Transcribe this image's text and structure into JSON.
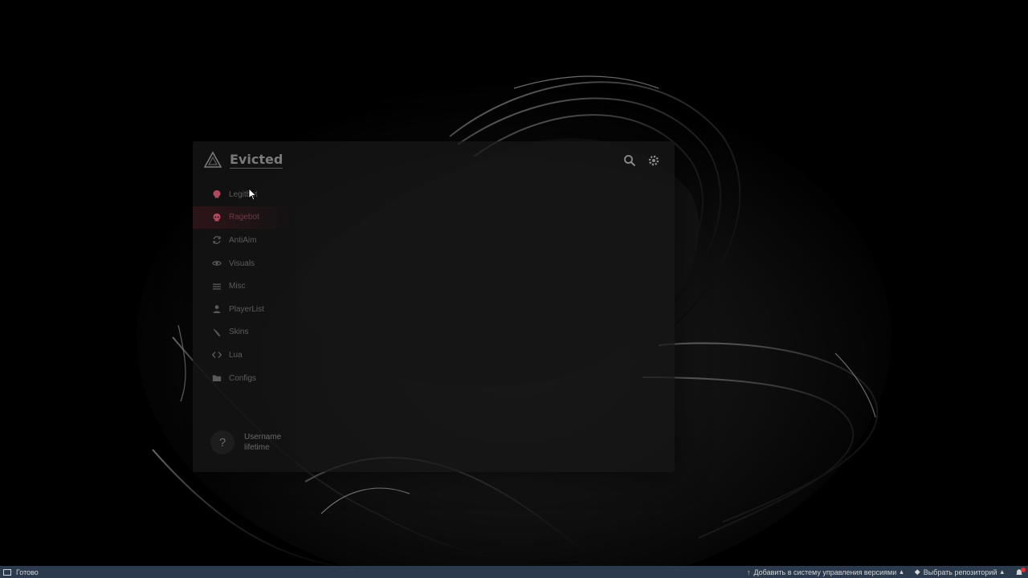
{
  "menu": {
    "title": "Evicted",
    "nav": [
      {
        "label": "Legitbot",
        "icon": "skull-icon"
      },
      {
        "label": "Ragebot",
        "icon": "skull-icon"
      },
      {
        "label": "AntiAim",
        "icon": "refresh-icon"
      },
      {
        "label": "Visuals",
        "icon": "eye-icon"
      },
      {
        "label": "Misc",
        "icon": "menu-icon"
      },
      {
        "label": "PlayerList",
        "icon": "user-icon"
      },
      {
        "label": "Skins",
        "icon": "knife-icon"
      },
      {
        "label": "Lua",
        "icon": "code-icon"
      },
      {
        "label": "Configs",
        "icon": "folder-icon"
      }
    ],
    "active_index": 1,
    "user": {
      "avatar_glyph": "?",
      "name": "Username",
      "sub": "lifetime"
    },
    "accent_color": "#b3485f"
  },
  "taskbar": {
    "status": "Готово",
    "add_vcs": "Добавить в систему управления версиями",
    "select_repo": "Выбрать репозиторий",
    "color": "#2b3a4d"
  }
}
